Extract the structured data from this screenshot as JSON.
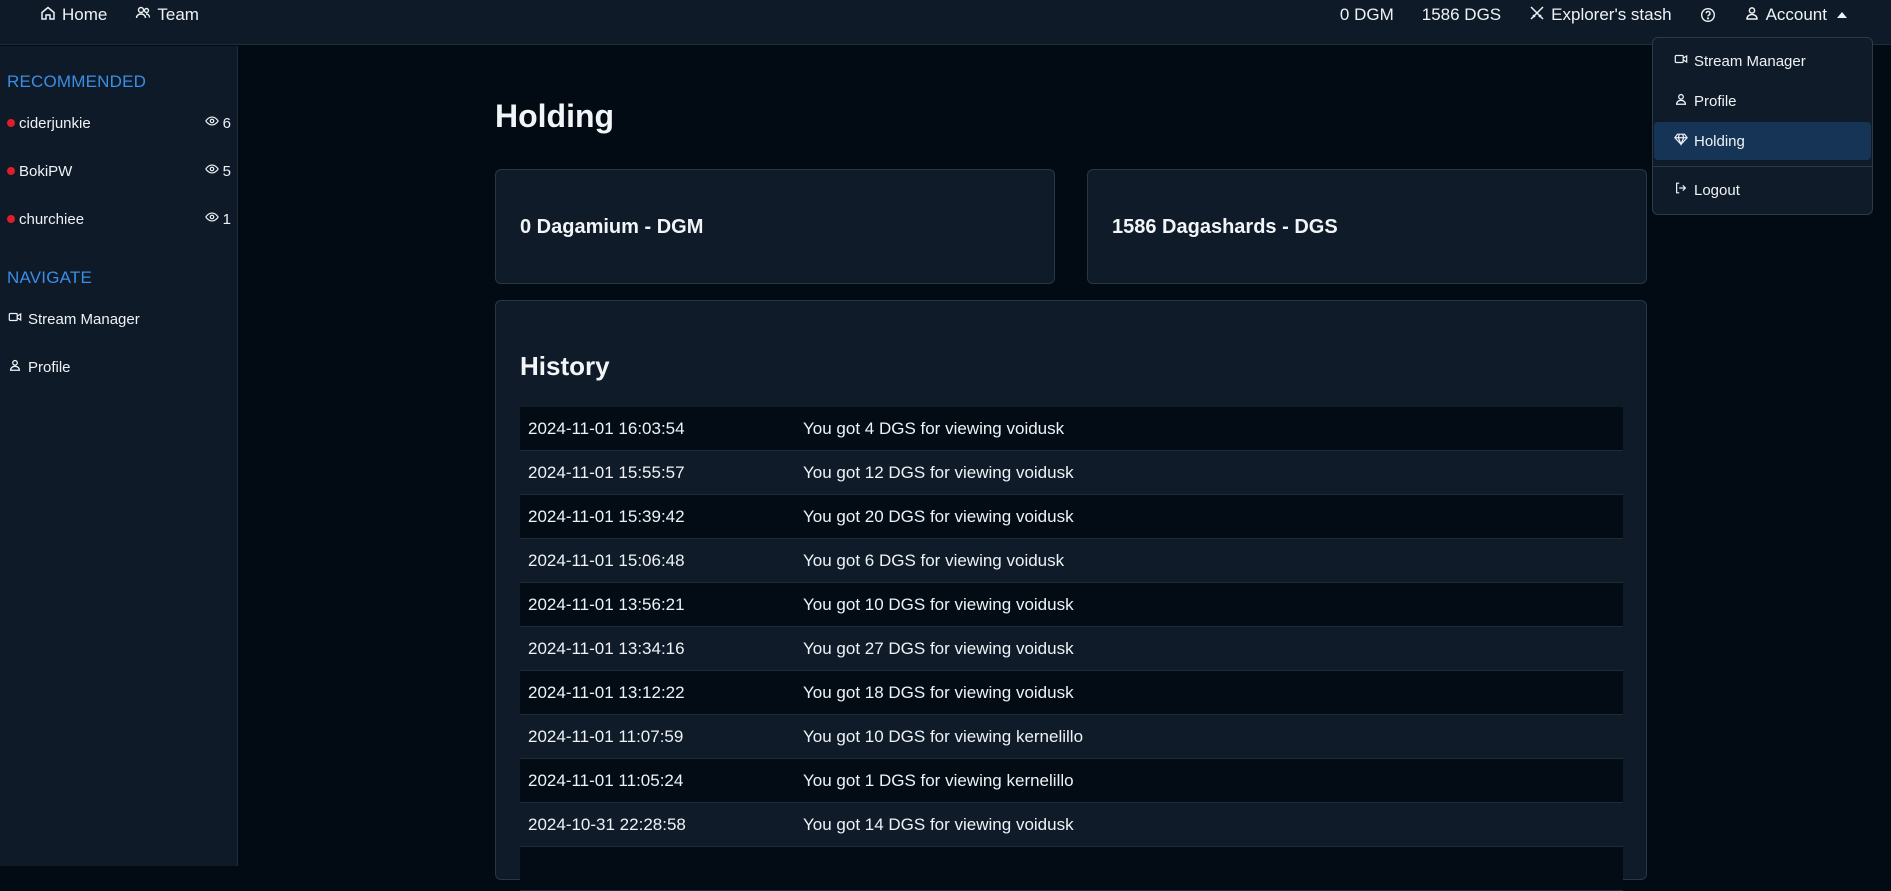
{
  "topbar": {
    "home_label": "Home",
    "team_label": "Team",
    "dgm_balance": "0 DGM",
    "dgs_balance": "1586 DGS",
    "stash_label": "Explorer's stash",
    "account_label": "Account"
  },
  "sidebar": {
    "recommended_heading": "RECOMMENDED",
    "streams": [
      {
        "name": "ciderjunkie",
        "viewers": "6"
      },
      {
        "name": "BokiPW",
        "viewers": "5"
      },
      {
        "name": "churchiee",
        "viewers": "1"
      }
    ],
    "navigate_heading": "NAVIGATE",
    "nav_items": [
      {
        "label": "Stream Manager"
      },
      {
        "label": "Profile"
      }
    ]
  },
  "main": {
    "title": "Holding",
    "cards": [
      {
        "label": "0 Dagamium - DGM"
      },
      {
        "label": "1586 Dagashards - DGS"
      }
    ],
    "history": {
      "title": "History",
      "rows": [
        {
          "date": "2024-11-01 16:03:54",
          "message": "You got 4 DGS for viewing voidusk"
        },
        {
          "date": "2024-11-01 15:55:57",
          "message": "You got 12 DGS for viewing voidusk"
        },
        {
          "date": "2024-11-01 15:39:42",
          "message": "You got 20 DGS for viewing voidusk"
        },
        {
          "date": "2024-11-01 15:06:48",
          "message": "You got 6 DGS for viewing voidusk"
        },
        {
          "date": "2024-11-01 13:56:21",
          "message": "You got 10 DGS for viewing voidusk"
        },
        {
          "date": "2024-11-01 13:34:16",
          "message": "You got 27 DGS for viewing voidusk"
        },
        {
          "date": "2024-11-01 13:12:22",
          "message": "You got 18 DGS for viewing voidusk"
        },
        {
          "date": "2024-11-01 11:07:59",
          "message": "You got 10 DGS for viewing kernelillo"
        },
        {
          "date": "2024-11-01 11:05:24",
          "message": "You got 1 DGS for viewing kernelillo"
        },
        {
          "date": "2024-10-31 22:28:58",
          "message": "You got 14 DGS for viewing voidusk"
        }
      ]
    }
  },
  "account_menu": {
    "items": [
      {
        "label": "Stream Manager"
      },
      {
        "label": "Profile"
      },
      {
        "label": "Holding"
      },
      {
        "label": "Logout"
      }
    ]
  },
  "colors": {
    "accent": "#3a8ee6",
    "live": "#e11d2a",
    "active_item": "#163556"
  }
}
